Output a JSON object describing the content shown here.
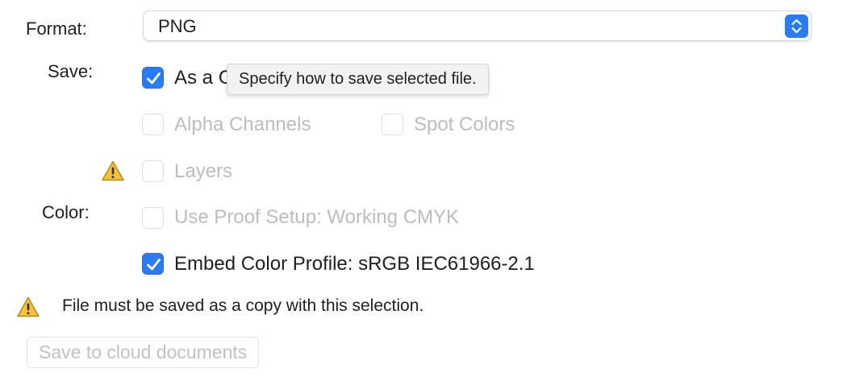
{
  "format": {
    "label": "Format:",
    "selected": "PNG"
  },
  "save": {
    "label": "Save:",
    "as_a_copy": {
      "label": "As a C",
      "checked": true
    },
    "alpha_channels": {
      "label": "Alpha Channels",
      "checked": false,
      "enabled": false
    },
    "spot_colors": {
      "label": "Spot Colors",
      "checked": false,
      "enabled": false
    },
    "layers": {
      "label": "Layers",
      "checked": false,
      "enabled": false
    }
  },
  "tooltip": {
    "text": "Specify how to save selected file."
  },
  "color": {
    "label": "Color:",
    "use_proof_setup": {
      "label": "Use Proof Setup:  Working CMYK",
      "checked": false,
      "enabled": false
    },
    "embed_profile": {
      "label": "Embed Color Profile:  sRGB IEC61966-2.1",
      "checked": true,
      "enabled": true
    }
  },
  "warning": {
    "message": "File must be saved as a copy with this selection."
  },
  "cloud_button": {
    "label": "Save to cloud documents",
    "enabled": false
  },
  "icons": {
    "stepper": "chevron-up-down-icon",
    "check": "checkmark-icon",
    "warning": "warning-triangle-icon"
  },
  "colors": {
    "accent": "#2a7cf6",
    "warning_yellow": "#f5c33b",
    "disabled_text": "#bdbdbd"
  }
}
